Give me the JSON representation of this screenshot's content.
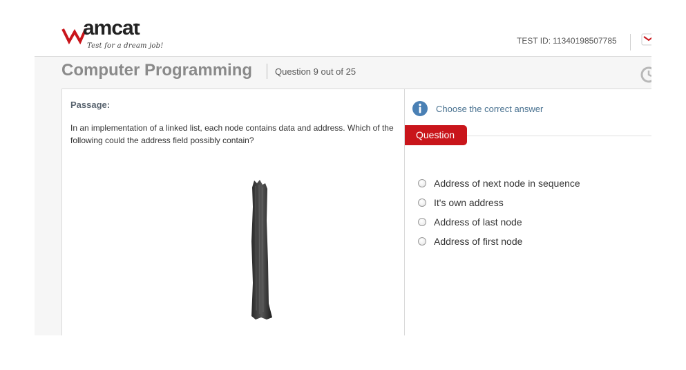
{
  "brand": {
    "wordmark": "amcat",
    "tagline": "Test for a dream job!",
    "color": "#c9151b"
  },
  "header": {
    "test_id_label": "TEST ID:",
    "test_id_value": "11340198507785",
    "icons": [
      "mail-icon"
    ]
  },
  "titlebar": {
    "title": "Computer Programming",
    "question_count": "Question 9 out of 25",
    "icons": [
      "clock-icon"
    ]
  },
  "passage": {
    "heading": "Passage:",
    "text": "In an implementation of a linked list, each node contains data and address. Which of the following could the address field possibly contain?"
  },
  "answer": {
    "icon": "info-icon",
    "instruction": "Choose the correct answer",
    "tab_label": "Question",
    "options": [
      {
        "label": "Address of next node in sequence",
        "selected": false
      },
      {
        "label": "It's own address",
        "selected": false
      },
      {
        "label": "Address of last node",
        "selected": false
      },
      {
        "label": "Address of first node",
        "selected": false
      }
    ]
  },
  "colors": {
    "accent_red": "#c9151b",
    "instruction_blue": "#47708f",
    "title_grey": "#8a8a8a"
  }
}
